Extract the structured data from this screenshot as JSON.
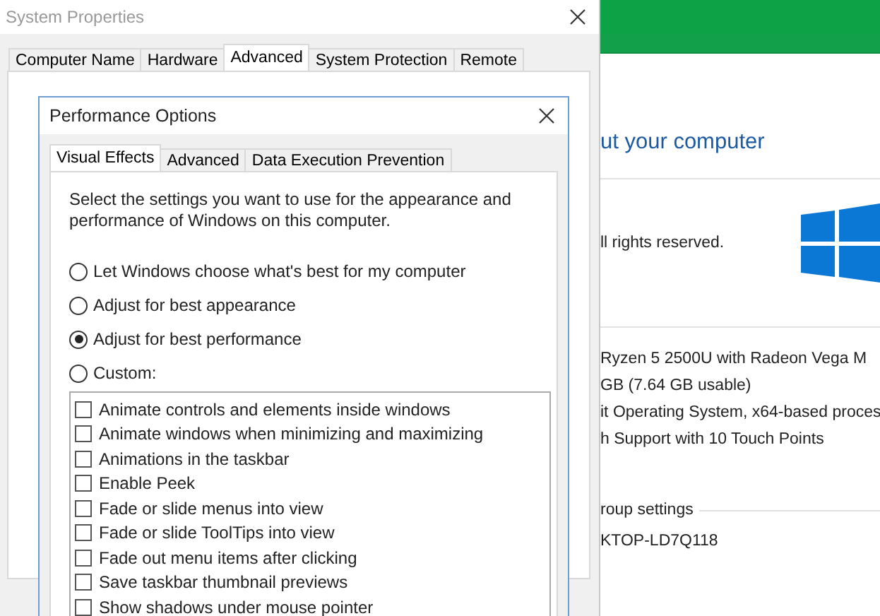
{
  "background_window": {
    "heading": "ut your computer",
    "copyright": "ll rights reserved.",
    "specs": [
      "Ryzen 5 2500U with Radeon Vega M",
      "GB (7.64 GB usable)",
      "it Operating System, x64-based proces",
      "h Support with 10 Touch Points"
    ],
    "section_title": "roup settings",
    "computer_name": "KTOP-LD7Q118"
  },
  "system_properties": {
    "title": "System Properties",
    "tabs": [
      {
        "label": "Computer Name",
        "selected": false
      },
      {
        "label": "Hardware",
        "selected": false
      },
      {
        "label": "Advanced",
        "selected": true
      },
      {
        "label": "System Protection",
        "selected": false
      },
      {
        "label": "Remote",
        "selected": false
      }
    ]
  },
  "performance_options": {
    "title": "Performance Options",
    "tabs": [
      {
        "label": "Visual Effects",
        "selected": true
      },
      {
        "label": "Advanced",
        "selected": false
      },
      {
        "label": "Data Execution Prevention",
        "selected": false
      }
    ],
    "description": "Select the settings you want to use for the appearance and performance of Windows on this computer.",
    "modes": [
      {
        "label": "Let Windows choose what's best for my computer",
        "selected": false
      },
      {
        "label": "Adjust for best appearance",
        "selected": false
      },
      {
        "label": "Adjust for best performance",
        "selected": true
      },
      {
        "label": "Custom:",
        "selected": false
      }
    ],
    "effects": [
      {
        "label": "Animate controls and elements inside windows",
        "checked": false
      },
      {
        "label": "Animate windows when minimizing and maximizing",
        "checked": false
      },
      {
        "label": "Animations in the taskbar",
        "checked": false
      },
      {
        "label": "Enable Peek",
        "checked": false
      },
      {
        "label": "Fade or slide menus into view",
        "checked": false
      },
      {
        "label": "Fade or slide ToolTips into view",
        "checked": false
      },
      {
        "label": "Fade out menu items after clicking",
        "checked": false
      },
      {
        "label": "Save taskbar thumbnail previews",
        "checked": false
      },
      {
        "label": "Show shadows under mouse pointer",
        "checked": false
      }
    ]
  }
}
